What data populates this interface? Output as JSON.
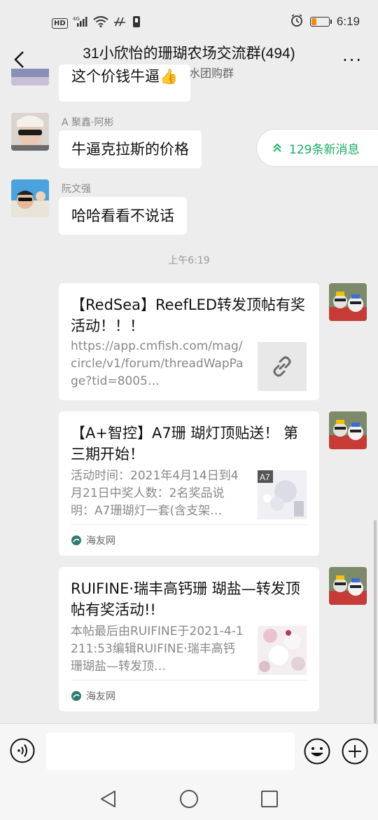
{
  "status": {
    "network": "4G",
    "hd": "HD",
    "time": "6:19",
    "battery_level": 0.3,
    "battery_color": "#f08c1c"
  },
  "header": {
    "title": "31小欣怡的珊瑚农场交流群(494)",
    "subtitle": "小欣怡海水团购群",
    "more": "···"
  },
  "messages": [
    {
      "sender": "",
      "text": "这个价钱牛逼👍"
    },
    {
      "sender": "A 聚鑫·阿彬",
      "text": "牛逼克拉斯的价格"
    },
    {
      "sender": "阮文强",
      "text": "哈哈看看不说话"
    }
  ],
  "timestamp": "上午6:19",
  "new_messages": {
    "label": "129条新消息",
    "icon": "double-chevron-up-icon"
  },
  "cards": [
    {
      "title": "【RedSea】ReefLED转发顶帖有奖活动！！！",
      "desc": "https://app.cmfish.com/mag/circle/v1/forum/threadWapPage?tid=8005…",
      "thumb": "link-icon",
      "source": ""
    },
    {
      "title": "【A+智控】A7珊 瑚灯顶贴送！ 第三期开始！",
      "desc": "活动时间：2021年4月14日到4月21日中奖人数：2名奖品说明：A7珊瑚灯一套(含支架…",
      "thumb_label": "A7",
      "source": "海友网"
    },
    {
      "title": "RUIFINE·瑞丰高钙珊 瑚盐—转发顶帖有奖活动!!",
      "desc": "本帖最后由RUIFINE于2021-4-1211:53编辑RUIFINE·瑞丰高钙珊瑚盐—转发顶…",
      "source": "海友网"
    }
  ],
  "colors": {
    "accent": "#1aad65",
    "background": "#ededed"
  }
}
